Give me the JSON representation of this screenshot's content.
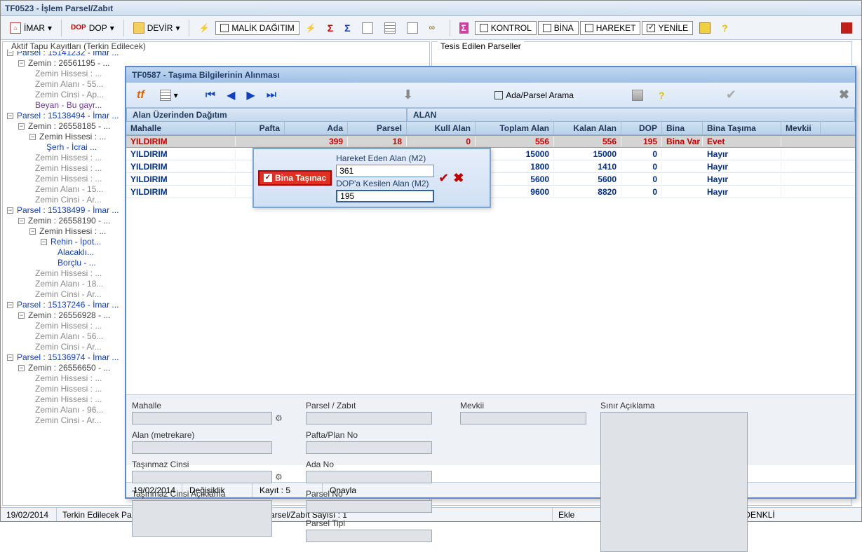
{
  "main": {
    "title": "TF0523 - İşlem Parsel/Zabıt",
    "toolbar": {
      "imar": "İMAR",
      "dop": "DOP",
      "devir": "DEVİR",
      "malik_dagitim": "MALİK DAĞITIM",
      "kontrol": "KONTROL",
      "bina": "BİNA",
      "hareket": "HAREKET",
      "yenile": "YENİLE"
    },
    "left_panel_title": "Aktif Tapu Kayıtları (Terkin Edilecek)",
    "right_panel_title": "Tesis Edilen Parseller",
    "tree": {
      "parsel1": "Parsel : 15141232 - İmar ...",
      "zemin1": "Zemin : 26561195 - ...",
      "zh1": "Zemin Hissesi : ...",
      "za1": "Zemin Alanı - 55...",
      "zc1": "Zemin Cinsi - Ap...",
      "beyan": "Beyan - Bu gayr...",
      "parsel2": "Parsel : 15138494 - İmar ...",
      "zemin2": "Zemin : 26558185 - ...",
      "zh2a": "Zemin Hissesi : ...",
      "serh": "Şerh - İcrai ...",
      "zh2b": "Zemin Hissesi : ...",
      "zh2c": "Zemin Hissesi : ...",
      "zh2d": "Zemin Hissesi : ...",
      "za2": "Zemin Alanı - 15...",
      "zc2": "Zemin Cinsi - Ar...",
      "parsel3": "Parsel : 15138499 - İmar ...",
      "zemin3": "Zemin : 26558190 - ...",
      "zh3a": "Zemin Hissesi : ...",
      "rehin": "Rehin - İpot...",
      "alacakli": "Alacaklı...",
      "borclu": "Borçlu - ...",
      "zh3b": "Zemin Hissesi : ...",
      "za3": "Zemin Alanı - 18...",
      "zc3": "Zemin Cinsi - Ar...",
      "parsel4": "Parsel : 15137246 - İmar ...",
      "zemin4": "Zemin : 26556928 - ...",
      "zh4": "Zemin Hissesi : ...",
      "za4": "Zemin Alanı - 56...",
      "zc4": "Zemin Cinsi - Ar...",
      "parsel5": "Parsel : 15136974 - İmar ...",
      "zemin5": "Zemin : 26556650 - ...",
      "zh5a": "Zemin Hissesi : ...",
      "zh5b": "Zemin Hissesi : ...",
      "zh5c": "Zemin Hissesi : ...",
      "za5": "Zemin Alanı - 96...",
      "zc5": "Zemin Cinsi - Ar..."
    },
    "status": {
      "date": "19/02/2014",
      "msg": "Terkin Edilecek Parsel/Zabıt Sayısı : 5, Tesis Edilecek Parsel/Zabıt Sayısı : 1",
      "ekle": "Ekle",
      "user": "Kullanıcı : İlhan DENKLİ"
    }
  },
  "dialog": {
    "title": "TF0587 - Taşıma Bilgilerinin Alınması",
    "search_label": "Ada/Parsel Arama",
    "bands": {
      "left": "Alan Üzerinden Dağıtım",
      "right": "ALAN"
    },
    "cols": {
      "mahalle": "Mahalle",
      "pafta": "Pafta",
      "ada": "Ada",
      "parsel": "Parsel",
      "kull": "Kull Alan",
      "top": "Toplam Alan",
      "kal": "Kalan Alan",
      "dop": "DOP",
      "bina": "Bina",
      "bt": "Bina Taşıma",
      "mev": "Mevkii"
    },
    "rows": [
      {
        "mah": "YILDIRIM",
        "paf": "",
        "ada": "399",
        "par": "18",
        "kull": "0",
        "top": "556",
        "kal": "556",
        "dop": "195",
        "bina": "Bina Var İ",
        "bt": "Evet",
        "mev": ""
      },
      {
        "mah": "YILDIRIM",
        "paf": "",
        "ada": "",
        "par": "",
        "kull": "",
        "top": "15000",
        "kal": "15000",
        "dop": "0",
        "bina": "",
        "bt": "Hayır",
        "mev": ""
      },
      {
        "mah": "YILDIRIM",
        "paf": "",
        "ada": "",
        "par": "",
        "kull": "",
        "top": "1800",
        "kal": "1410",
        "dop": "0",
        "bina": "",
        "bt": "Hayır",
        "mev": ""
      },
      {
        "mah": "YILDIRIM",
        "paf": "",
        "ada": "",
        "par": "",
        "kull": "",
        "top": "5600",
        "kal": "5600",
        "dop": "0",
        "bina": "",
        "bt": "Hayır",
        "mev": ""
      },
      {
        "mah": "YILDIRIM",
        "paf": "",
        "ada": "",
        "par": "",
        "kull": "",
        "top": "9600",
        "kal": "8820",
        "dop": "0",
        "bina": "",
        "bt": "Hayır",
        "mev": ""
      }
    ],
    "form": {
      "mahalle": "Mahalle",
      "parsel_zabit": "Parsel / Zabıt",
      "mevkii": "Mevkii",
      "sinir": "Sınır Açıklama",
      "alan_m2": "Alan (metrekare)",
      "pafta_plan": "Pafta/Plan No",
      "tasinmaz_cinsi": "Taşınmaz Cinsi",
      "ada_no": "Ada No",
      "tc_aciklama": "Taşınmaz Cinsi Açıklama",
      "parsel_no": "Parsel No",
      "parsel_tipi": "Parsel Tipi"
    },
    "status": {
      "date": "19/02/2014",
      "mode": "Değişiklik",
      "kayit": "Kayıt : 5",
      "onayla": "Onayla"
    }
  },
  "popup": {
    "tasinac": "Bina Taşınac",
    "hareket_label": "Hareket Eden Alan (M2)",
    "hareket_val": "361",
    "dop_label": "DOP'a Kesilen Alan (M2)",
    "dop_val": "195"
  }
}
